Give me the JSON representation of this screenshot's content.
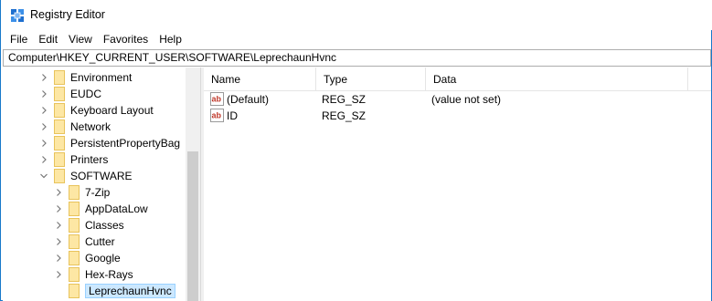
{
  "window": {
    "title": "Registry Editor",
    "accent": "#1979ca"
  },
  "menu": [
    "File",
    "Edit",
    "View",
    "Favorites",
    "Help"
  ],
  "address": "Computer\\HKEY_CURRENT_USER\\SOFTWARE\\LeprechaunHvnc",
  "tree": {
    "items": [
      {
        "label": "Environment",
        "level": 1,
        "expander": "collapsed"
      },
      {
        "label": "EUDC",
        "level": 1,
        "expander": "collapsed"
      },
      {
        "label": "Keyboard Layout",
        "level": 1,
        "expander": "collapsed"
      },
      {
        "label": "Network",
        "level": 1,
        "expander": "collapsed"
      },
      {
        "label": "PersistentPropertyBag",
        "level": 1,
        "expander": "collapsed"
      },
      {
        "label": "Printers",
        "level": 1,
        "expander": "collapsed"
      },
      {
        "label": "SOFTWARE",
        "level": 1,
        "expander": "expanded"
      },
      {
        "label": "7-Zip",
        "level": 2,
        "expander": "collapsed"
      },
      {
        "label": "AppDataLow",
        "level": 2,
        "expander": "collapsed"
      },
      {
        "label": "Classes",
        "level": 2,
        "expander": "collapsed"
      },
      {
        "label": "Cutter",
        "level": 2,
        "expander": "collapsed"
      },
      {
        "label": "Google",
        "level": 2,
        "expander": "collapsed"
      },
      {
        "label": "Hex-Rays",
        "level": 2,
        "expander": "collapsed"
      },
      {
        "label": "LeprechaunHvnc",
        "level": 2,
        "expander": "none",
        "selected": true
      }
    ]
  },
  "list": {
    "columns": [
      "Name",
      "Type",
      "Data"
    ],
    "rows": [
      {
        "name": "(Default)",
        "type": "REG_SZ",
        "data": "(value not set)",
        "icon": "string-value-icon"
      },
      {
        "name": "ID",
        "type": "REG_SZ",
        "data": "",
        "icon": "string-value-icon"
      }
    ]
  }
}
